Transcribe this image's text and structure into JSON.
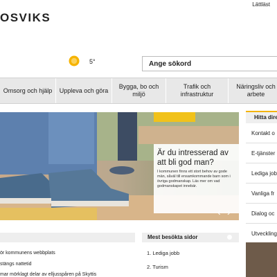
{
  "header": {
    "logo_text": "OSVIKS",
    "lattlast_link": "Lättläst",
    "temperature": "5°",
    "search_placeholder": "Ange sökord"
  },
  "nav": {
    "items": [
      {
        "label": "Omsorg och hjälp"
      },
      {
        "label": "Uppleva och göra"
      },
      {
        "label": "Bygga, bo och miljö"
      },
      {
        "label": "Trafik och infrastruktur"
      },
      {
        "label": "Näringsliv och arbete"
      }
    ]
  },
  "hero": {
    "title": "Är du intresserad av att bli god man?",
    "text": "I kommunen finns ett stort behov av gode män, såväl till ensamkommande barn som i övriga godmanskap. Läs mer om vad godmanskapet innebär.",
    "prev_arrow": "‹",
    "next_arrow": "›"
  },
  "sidebar": {
    "header": "Hitta dire",
    "items": [
      "Kontakt o",
      "E-tjänster",
      "Lediga job",
      "Vanliga fr",
      "Dialog oc",
      "Utveckling"
    ]
  },
  "news": {
    "items": [
      "ör kommunens webbplats",
      "stängs nattetid",
      "mar mörklagt delar av elljusspåren på Skyttis"
    ]
  },
  "most_visited": {
    "header": "Mest besökta sidor",
    "items": [
      "1.  Lediga jobb",
      "2.  Turism"
    ]
  },
  "colors": {
    "accent": "#f4b400",
    "nav_bg": "#e8e8e8"
  }
}
